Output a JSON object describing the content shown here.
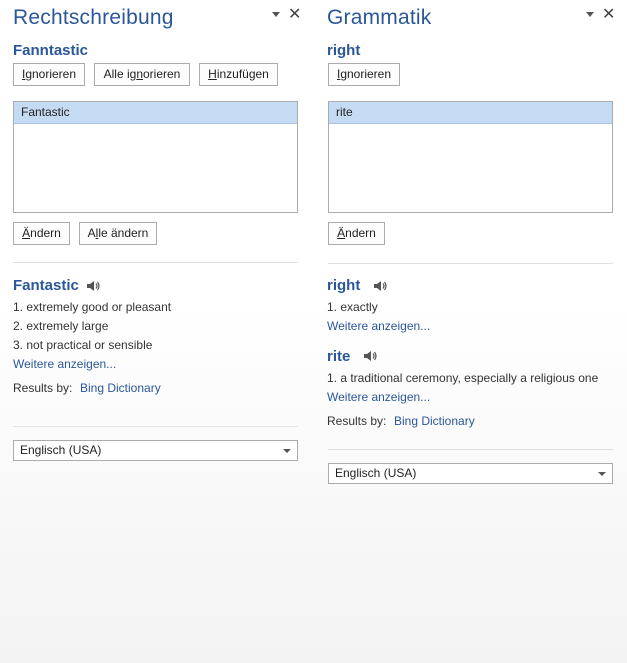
{
  "spelling": {
    "title": "Rechtschreibung",
    "misspelled_word": "Fanntastic",
    "buttons": {
      "ignore_pre": "",
      "ignore_u": "I",
      "ignore_post": "gnorieren",
      "ignore_all_pre": "Alle ig",
      "ignore_all_u": "n",
      "ignore_all_post": "orieren",
      "add_pre": "",
      "add_u": "H",
      "add_post": "inzufügen",
      "change_pre": "",
      "change_u": "Ä",
      "change_post": "ndern",
      "change_all_pre": "A",
      "change_all_u": "l",
      "change_all_post": "le ändern"
    },
    "suggestions": [
      "Fantastic"
    ],
    "definition": {
      "word": "Fantastic",
      "items": [
        "1. extremely good or pleasant",
        "2. extremely large",
        "3. not practical or sensible"
      ],
      "more": "Weitere anzeigen..."
    },
    "results_label": "Results by:",
    "results_source": "Bing Dictionary",
    "language": "Englisch (USA)"
  },
  "grammar": {
    "title": "Grammatik",
    "flagged_word": "right",
    "buttons": {
      "ignore_pre": "",
      "ignore_u": "I",
      "ignore_post": "gnorieren",
      "change_pre": "",
      "change_u": "Ä",
      "change_post": "ndern"
    },
    "suggestions": [
      "rite"
    ],
    "definitions": [
      {
        "word": "right",
        "items": [
          "1. exactly"
        ],
        "more": "Weitere anzeigen..."
      },
      {
        "word": "rite",
        "items": [
          "1. a traditional ceremony, especially a religious one"
        ],
        "more": "Weitere anzeigen..."
      }
    ],
    "results_label": "Results by:",
    "results_source": "Bing Dictionary",
    "language": "Englisch (USA)"
  },
  "colors": {
    "accent": "#2b579a",
    "selection": "#c5daf3"
  },
  "icons": {
    "pane_menu": "chevron-down-icon",
    "pane_close": "close-icon",
    "audio": "speaker-icon"
  }
}
